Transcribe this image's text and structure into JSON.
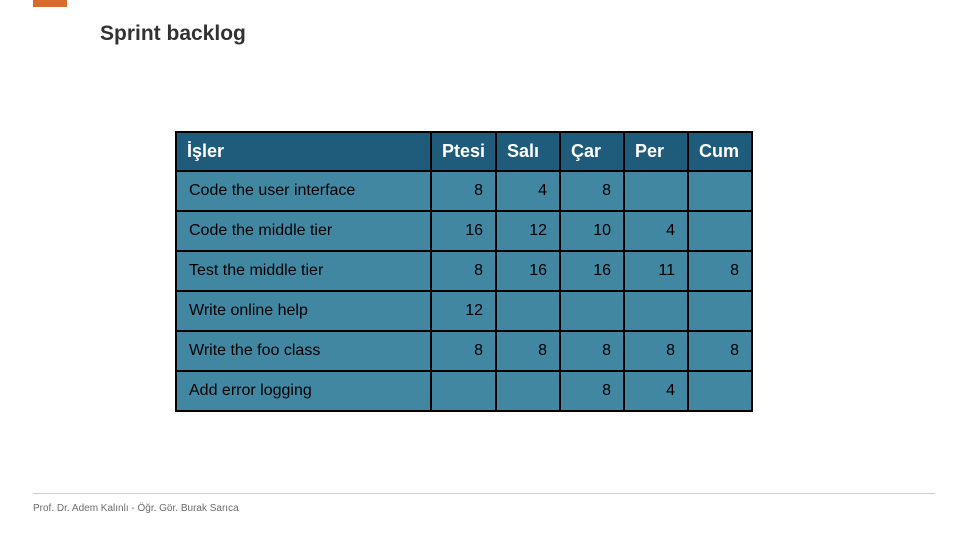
{
  "title": "Sprint backlog",
  "footer": "Prof. Dr. Adem Kalınlı - Öğr. Gör. Burak Sarıca",
  "table": {
    "headers": [
      "İşler",
      "Ptesi",
      "Salı",
      "Çar",
      "Per",
      "Cum"
    ],
    "rows": [
      {
        "task": "Code the user interface",
        "d": [
          "8",
          "4",
          "8",
          "",
          ""
        ]
      },
      {
        "task": "Code the middle tier",
        "d": [
          "16",
          "12",
          "10",
          "4",
          ""
        ]
      },
      {
        "task": "Test the middle tier",
        "d": [
          "8",
          "16",
          "16",
          "11",
          "8"
        ]
      },
      {
        "task": "Write online help",
        "d": [
          "12",
          "",
          "",
          "",
          ""
        ]
      },
      {
        "task": "Write the foo class",
        "d": [
          "8",
          "8",
          "8",
          "8",
          "8"
        ]
      },
      {
        "task": "Add error logging",
        "d": [
          "",
          "",
          "8",
          "4",
          ""
        ]
      }
    ]
  },
  "chart_data": {
    "type": "table",
    "title": "Sprint backlog",
    "columns": [
      "İşler",
      "Ptesi",
      "Salı",
      "Çar",
      "Per",
      "Cum"
    ],
    "rows": [
      [
        "Code the user interface",
        8,
        4,
        8,
        null,
        null
      ],
      [
        "Code the middle tier",
        16,
        12,
        10,
        4,
        null
      ],
      [
        "Test the middle tier",
        8,
        16,
        16,
        11,
        8
      ],
      [
        "Write online help",
        12,
        null,
        null,
        null,
        null
      ],
      [
        "Write the foo class",
        8,
        8,
        8,
        8,
        8
      ],
      [
        "Add error logging",
        null,
        null,
        8,
        4,
        null
      ]
    ]
  }
}
